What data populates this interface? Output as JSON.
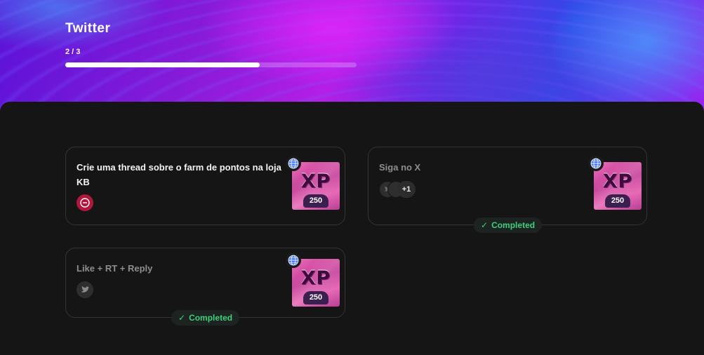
{
  "header": {
    "title": "Twitter",
    "progress_text": "2 / 3",
    "progress_fraction": 0.667
  },
  "tasks": [
    {
      "title": "Crie uma thread sobre o farm de pontos na loja KB",
      "status": "active",
      "icon": "link-icon",
      "icon_color": "#b0173c",
      "xp_label": "XP",
      "xp_value": "250"
    },
    {
      "title": "Siga no X",
      "status": "completed",
      "icon": "avatar-stack",
      "avatar_more": "+1",
      "xp_label": "XP",
      "xp_value": "250",
      "completed_label": "Completed"
    },
    {
      "title": "Like + RT + Reply",
      "status": "completed",
      "icon": "twitter-bird-icon",
      "xp_label": "XP",
      "xp_value": "250",
      "completed_label": "Completed"
    }
  ],
  "colors": {
    "accent_green": "#3fd07a",
    "background": "#151515",
    "globe_blue": "#4c7cf2"
  }
}
